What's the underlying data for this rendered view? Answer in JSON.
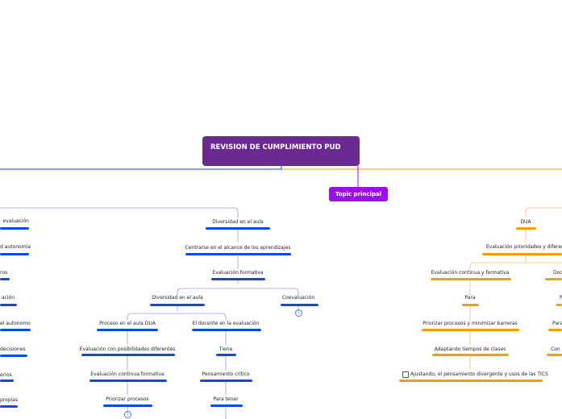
{
  "root": {
    "title": "REVISION DE CUMPLIMIENTO PUD"
  },
  "topic": {
    "label": "Topic principal"
  },
  "left": {
    "items": [
      "evaluación",
      "d autonomía",
      "ros",
      "ación",
      "el autonomo",
      "decisiones",
      "erios",
      "propias"
    ]
  },
  "center": {
    "diversidad_aula": "Diversidad en el aula",
    "centrarse": "Centrarse en el alcance de los aprendizajes",
    "eval_formativa": "Evaluación formativa",
    "diversidad_aula2": "Diversidad en el aula",
    "coevaluacion": "Coevaluación",
    "proceso_dua": "Proceso en el aula DUA",
    "docente_eval": "El docente en la evaluación",
    "eval_posibilidades": "Evaluación con posibilidades diferentes",
    "tiene": "Tiene",
    "eval_continua": "Evaluación  continua formativa",
    "pensamiento": "Pensamiento crítico",
    "priorizar": "Priorizar procesos",
    "para_tener": "Para tener",
    "collapse_count": "1"
  },
  "right": {
    "dua": "DUA",
    "eval_prioridades": "Evaluación prioridades y diferencia",
    "eval_cont_form": "Evaluación continua y formativa",
    "doc_partial": "Doc",
    "para": "Para",
    "p_partial": "P",
    "priorizar_barreras": "Priorizar procesos y minimizar barreras",
    "para_partial": "Para",
    "adaptando": "Adaptando tiempos de clases",
    "con_partial": "Con e",
    "ajustando": "Ajustando, el pensamiento divergente y usos de las TICS"
  },
  "colors": {
    "root": "#6a2a91",
    "topic": "#9b10e8",
    "blue": "#0a4be8",
    "orange": "#f5a000"
  }
}
